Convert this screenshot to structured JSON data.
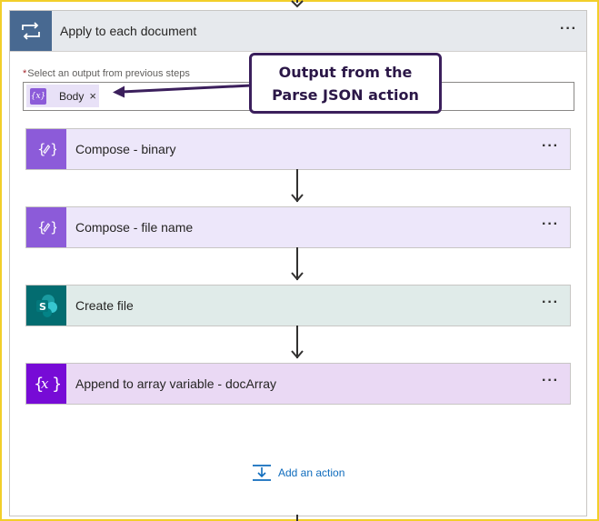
{
  "loop": {
    "title": "Apply to each document",
    "more_label": "···",
    "field": {
      "required_marker": "*",
      "label": "Select an output from previous steps",
      "token": {
        "label": "Body",
        "close": "×",
        "icon": "expression-icon"
      }
    },
    "actions": [
      {
        "title": "Compose - binary",
        "icon": "compose-icon",
        "color": "#8c5bd9",
        "bg": "#ede7fa",
        "more": "···"
      },
      {
        "title": "Compose - file name",
        "icon": "compose-icon",
        "color": "#8c5bd9",
        "bg": "#ede7fa",
        "more": "···"
      },
      {
        "title": "Create file",
        "icon": "sharepoint-icon",
        "color": "#036c70",
        "bg": "#e0ebe9",
        "more": "···"
      },
      {
        "title": "Append to array variable - docArray",
        "icon": "variable-icon",
        "color": "#770bd6",
        "bg": "#ead9f4",
        "more": "···"
      }
    ],
    "add_action_label": "Add an action"
  },
  "callout": {
    "line1": "Output from the",
    "line2": "Parse JSON action"
  },
  "colors": {
    "frame": "#f2cf2a",
    "loop_header_icon": "#486991",
    "link": "#0f6cbd",
    "callout_border": "#3b1f5c"
  }
}
